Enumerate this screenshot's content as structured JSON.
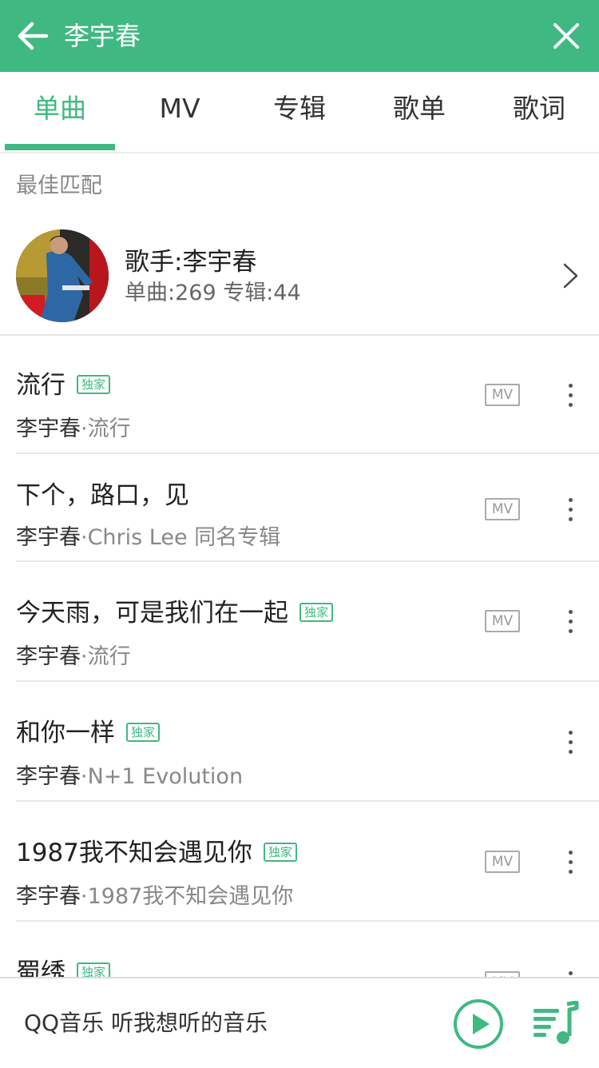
{
  "header": {
    "title": "李宇春",
    "back_icon": "arrow-left-icon",
    "close_icon": "close-icon",
    "color": "#3fb981"
  },
  "tabs": [
    {
      "label": "单曲",
      "active": true
    },
    {
      "label": "MV",
      "active": false
    },
    {
      "label": "专辑",
      "active": false
    },
    {
      "label": "歌单",
      "active": false
    },
    {
      "label": "歌词",
      "active": false
    }
  ],
  "best_match": {
    "label": "最佳匹配",
    "artist_name": "歌手:李宇春",
    "stats": "单曲:269 专辑:44"
  },
  "songs": [
    {
      "title": "流行",
      "badge": "独家",
      "artist": "李宇春",
      "album": "·流行",
      "mv": "MV"
    },
    {
      "title": "下个，路口，见",
      "badge": "",
      "artist": "李宇春",
      "album": "·Chris Lee 同名专辑",
      "mv": "MV"
    },
    {
      "title": "今天雨，可是我们在一起",
      "badge": "独家",
      "artist": "李宇春",
      "album": "·流行",
      "mv": "MV"
    },
    {
      "title": "和你一样",
      "badge": "独家",
      "artist": "李宇春",
      "album": "·N+1 Evolution",
      "mv": ""
    },
    {
      "title": "1987我不知会遇见你",
      "badge": "独家",
      "artist": "李宇春",
      "album": "·1987我不知会遇见你",
      "mv": "MV"
    },
    {
      "title": "蜀绣",
      "badge": "独家",
      "artist": "",
      "album": "",
      "mv": "MV"
    }
  ],
  "bottom_bar": {
    "text": "QQ音乐 听我想听的音乐",
    "play_icon": "play-circle-icon",
    "playlist_icon": "playlist-icon"
  }
}
